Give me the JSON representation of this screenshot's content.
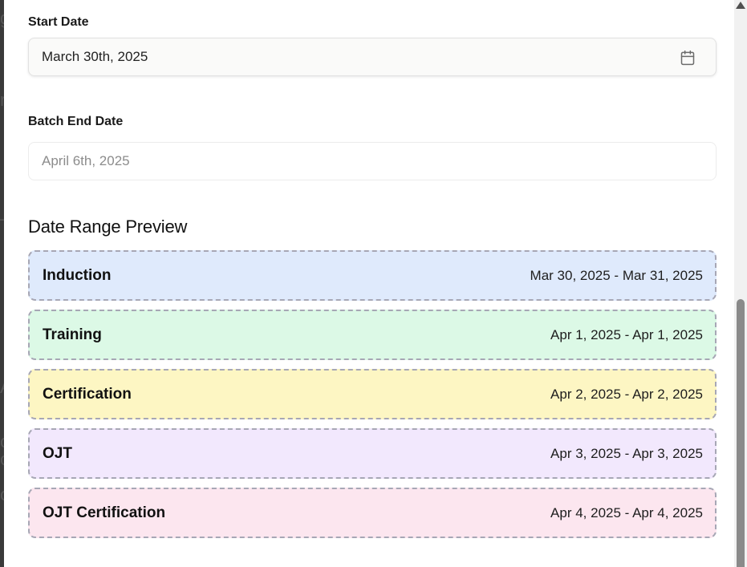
{
  "backdrop": {
    "bleed_chars": [
      "g",
      "r",
      "–",
      "A",
      "c",
      "c",
      "o"
    ]
  },
  "form": {
    "start_date": {
      "label": "Start Date",
      "value": "March 30th, 2025",
      "icon": "calendar-icon"
    },
    "end_date": {
      "label": "Batch End Date",
      "value": "April 6th, 2025"
    }
  },
  "preview": {
    "title": "Date Range Preview",
    "phases": [
      {
        "name": "Induction",
        "range": "Mar 30, 2025 - Mar 31, 2025",
        "color": "#dfeafc"
      },
      {
        "name": "Training",
        "range": "Apr 1, 2025 - Apr 1, 2025",
        "color": "#dcf9e6"
      },
      {
        "name": "Certification",
        "range": "Apr 2, 2025 - Apr 2, 2025",
        "color": "#fdf6c3"
      },
      {
        "name": "OJT",
        "range": "Apr 3, 2025 - Apr 3, 2025",
        "color": "#f2e8fd"
      },
      {
        "name": "OJT Certification",
        "range": "Apr 4, 2025 - Apr 4, 2025",
        "color": "#fce6ef"
      }
    ]
  },
  "colors": {
    "phase_border": "#a7a7b5",
    "scroll_thumb": "#8a8a8a"
  }
}
